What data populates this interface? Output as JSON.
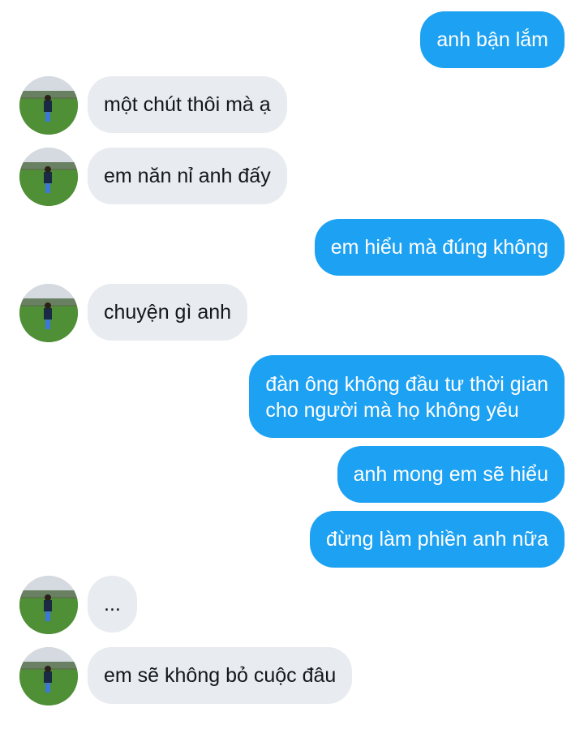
{
  "conversation": {
    "messages": [
      {
        "direction": "sent",
        "text": "anh bận lắm"
      },
      {
        "direction": "received",
        "text": "một chút thôi mà ạ"
      },
      {
        "direction": "received",
        "text": "em năn nỉ anh đấy"
      },
      {
        "direction": "sent",
        "text": "em hiểu mà đúng không"
      },
      {
        "direction": "received",
        "text": "chuyện gì anh"
      },
      {
        "direction": "sent",
        "lines": [
          "đàn ông không đầu tư thời gian",
          "cho người mà họ không yêu"
        ]
      },
      {
        "direction": "sent",
        "text": "anh mong em sẽ hiểu"
      },
      {
        "direction": "sent",
        "text": "đừng làm phiền anh nữa"
      },
      {
        "direction": "received",
        "text": "..."
      },
      {
        "direction": "received",
        "text": "em sẽ không bỏ cuộc đâu"
      }
    ]
  },
  "colors": {
    "sent_bubble": "#1da1f2",
    "received_bubble": "#e8ebef",
    "sent_text": "#ffffff",
    "received_text": "#14171a"
  }
}
